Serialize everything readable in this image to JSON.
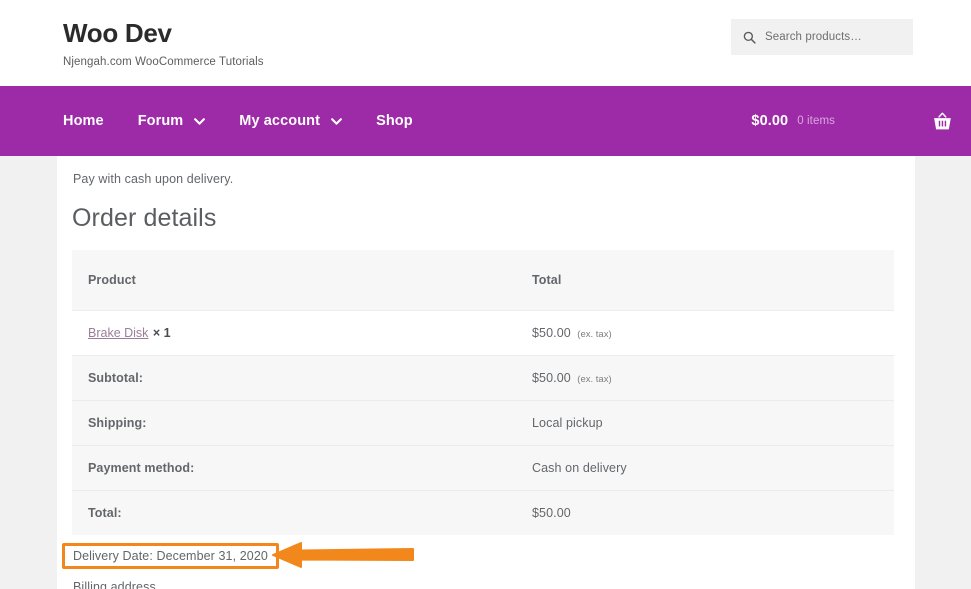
{
  "header": {
    "site_title": "Woo Dev",
    "tagline": "Njengah.com WooCommerce Tutorials",
    "search": {
      "icon": "search-icon",
      "placeholder": "Search products…",
      "value": ""
    }
  },
  "nav": {
    "background_color": "#9d2aa6",
    "items": [
      {
        "label": "Home",
        "has_dropdown": false
      },
      {
        "label": "Forum",
        "has_dropdown": true
      },
      {
        "label": "My account",
        "has_dropdown": true
      },
      {
        "label": "Shop",
        "has_dropdown": false
      }
    ],
    "cart": {
      "amount": "$0.00",
      "items_count": "0 items",
      "icon": "shopping-basket-icon"
    }
  },
  "main": {
    "payment_note": "Pay with cash upon delivery.",
    "order_details_heading": "Order details",
    "table": {
      "headers": [
        "Product",
        "Total"
      ],
      "rows": [
        {
          "type": "product",
          "product_name": "Brake Disk",
          "quantity": "× 1",
          "value": "$50.00",
          "value_note": "(ex. tax)"
        },
        {
          "type": "summary",
          "label": "Subtotal:",
          "value": "$50.00",
          "value_note": "(ex. tax)"
        },
        {
          "type": "summary",
          "label": "Shipping:",
          "value": "Local pickup",
          "value_note": ""
        },
        {
          "type": "summary",
          "label": "Payment method:",
          "value": "Cash on delivery",
          "value_note": ""
        },
        {
          "type": "summary",
          "label": "Total:",
          "value": "$50.00",
          "value_note": ""
        }
      ]
    },
    "delivery_date": {
      "text": "Delivery Date: December 31, 2020",
      "highlight_color": "#f2881c",
      "annotation": "arrow-pointing-left"
    },
    "cut_off_line": "Billing address"
  }
}
